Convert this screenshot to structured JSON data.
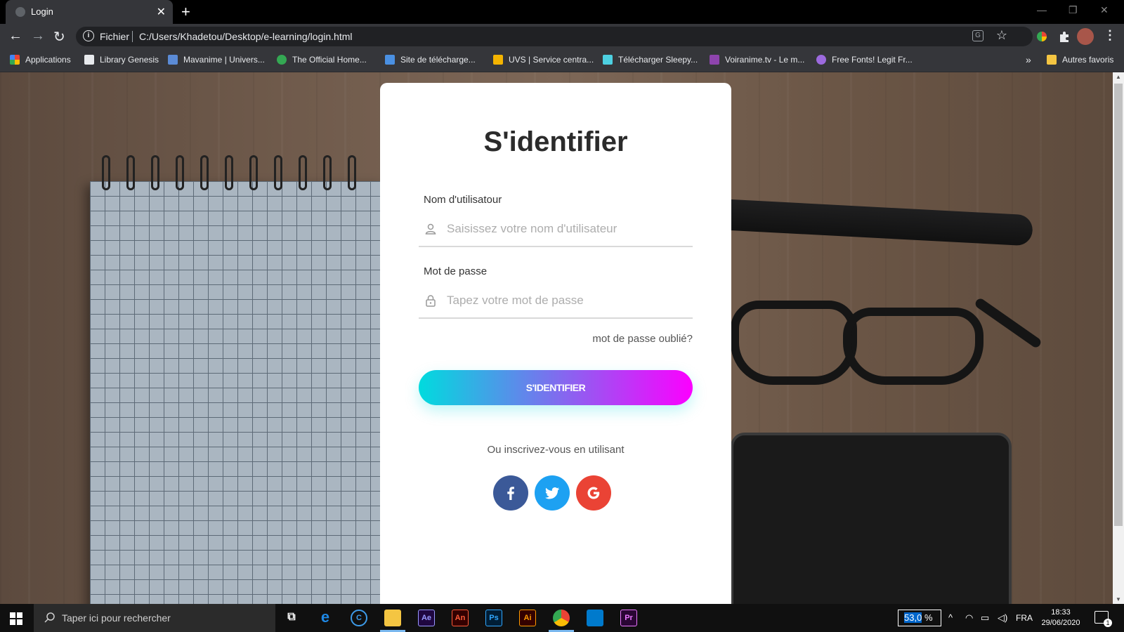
{
  "browser": {
    "tab_title": "Login",
    "address_scheme": "Fichier",
    "url": "C:/Users/Khadetou/Desktop/e-learning/login.html",
    "bookmarks": [
      {
        "label": "Applications",
        "icon": "apps-grid-icon",
        "color": "#ea4335"
      },
      {
        "label": "Library Genesis",
        "icon": "library-icon",
        "color": "#e8eaed"
      },
      {
        "label": "Mavanime | Univers...",
        "icon": "mavanime-icon",
        "color": "#5b8bd6"
      },
      {
        "label": "The Official Home...",
        "icon": "official-home-icon",
        "color": "#34a853"
      },
      {
        "label": "Site de télécharge...",
        "icon": "download-arrow-icon",
        "color": "#4a90e2"
      },
      {
        "label": "UVS | Service centra...",
        "icon": "uvs-icon",
        "color": "#f4b400"
      },
      {
        "label": "Télécharger Sleepy...",
        "icon": "sleepy-icon",
        "color": "#4dd0e1"
      },
      {
        "label": "Voiranime.tv - Le m...",
        "icon": "voiranime-icon",
        "color": "#8e44ad"
      },
      {
        "label": "Free Fonts! Legit Fr...",
        "icon": "fonts-icon",
        "color": "#9c6ade"
      }
    ],
    "more_bookmarks_label": "»",
    "other_favorites": "Autres favoris"
  },
  "login": {
    "title": "S'identifier",
    "username_label": "Nom d'utilisatour",
    "username_placeholder": "Saisissez votre nom d'utilisateur",
    "password_label": "Mot de passe",
    "password_placeholder": "Tapez votre mot de passe",
    "forgot": "mot de passe oublié?",
    "submit": "S'IDENTIFIER",
    "signup_text": "Ou inscrivez-vous en utilisant",
    "social": [
      {
        "name": "facebook",
        "icon": "facebook-icon",
        "color": "#3b5998"
      },
      {
        "name": "twitter",
        "icon": "twitter-icon",
        "color": "#1da1f2"
      },
      {
        "name": "google",
        "icon": "google-icon",
        "color": "#ea4335"
      }
    ],
    "gradient": {
      "from": "#00dbde",
      "to": "#fc00ff"
    }
  },
  "taskbar": {
    "search_placeholder": "Taper ici pour rechercher",
    "apps": [
      {
        "name": "task-view",
        "label": ""
      },
      {
        "name": "edge",
        "label": "e"
      },
      {
        "name": "ccleaner",
        "label": "C"
      },
      {
        "name": "file-explorer",
        "label": ""
      },
      {
        "name": "after-effects",
        "label": "Ae"
      },
      {
        "name": "animate",
        "label": "An"
      },
      {
        "name": "photoshop",
        "label": "Ps"
      },
      {
        "name": "illustrator",
        "label": "Ai"
      },
      {
        "name": "chrome",
        "label": ""
      },
      {
        "name": "vscode",
        "label": ""
      },
      {
        "name": "premiere",
        "label": "Pr"
      }
    ],
    "zoom_value": "53,0",
    "zoom_unit": "%",
    "language": "FRA",
    "time": "18:33",
    "date": "29/06/2020",
    "notifications": "1"
  }
}
